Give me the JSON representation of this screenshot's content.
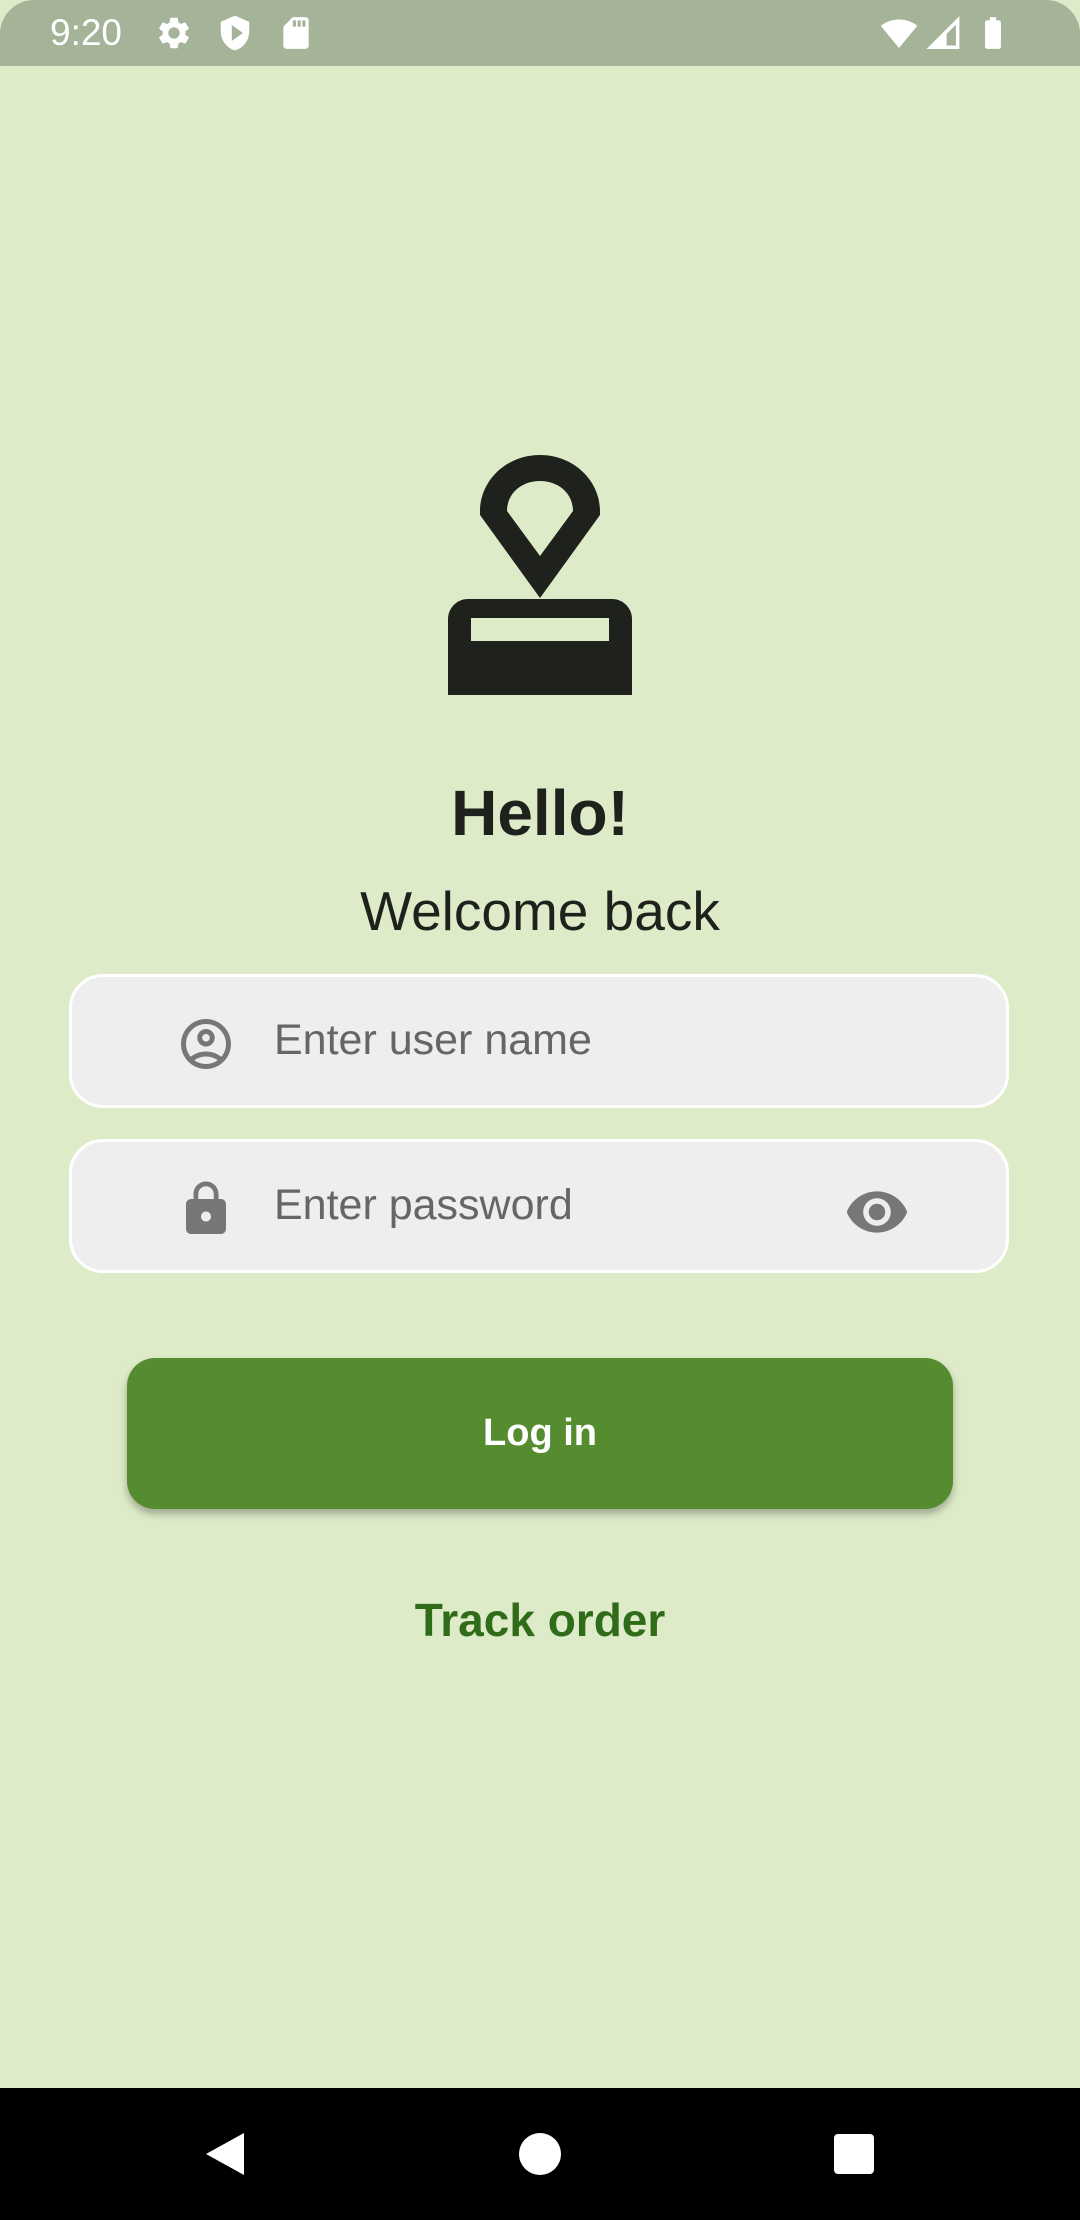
{
  "status_bar": {
    "time": "9:20",
    "left_icons": [
      "settings-icon",
      "shield-icon",
      "sd-card-icon"
    ],
    "right_icons": [
      "wifi-icon",
      "cell-signal-icon",
      "battery-icon"
    ]
  },
  "logo": {
    "icon": "location-stamp-icon",
    "color": "#1e211c"
  },
  "header": {
    "greeting": "Hello!",
    "subtitle": "Welcome back"
  },
  "form": {
    "username": {
      "placeholder": "Enter user name",
      "value": "",
      "icon": "account-circle-icon"
    },
    "password": {
      "placeholder": "Enter password",
      "value": "",
      "icon": "lock-icon",
      "toggle_icon": "eye-icon"
    }
  },
  "actions": {
    "login_label": "Log in",
    "track_label": "Track order"
  },
  "nav_bar": {
    "buttons": [
      "back-icon",
      "home-icon",
      "recents-icon"
    ]
  },
  "colors": {
    "background": "#ddebc8",
    "status_bar": "#a5b398",
    "primary": "#548c2f",
    "link": "#2f6b18",
    "field_bg": "#eeeeee"
  }
}
